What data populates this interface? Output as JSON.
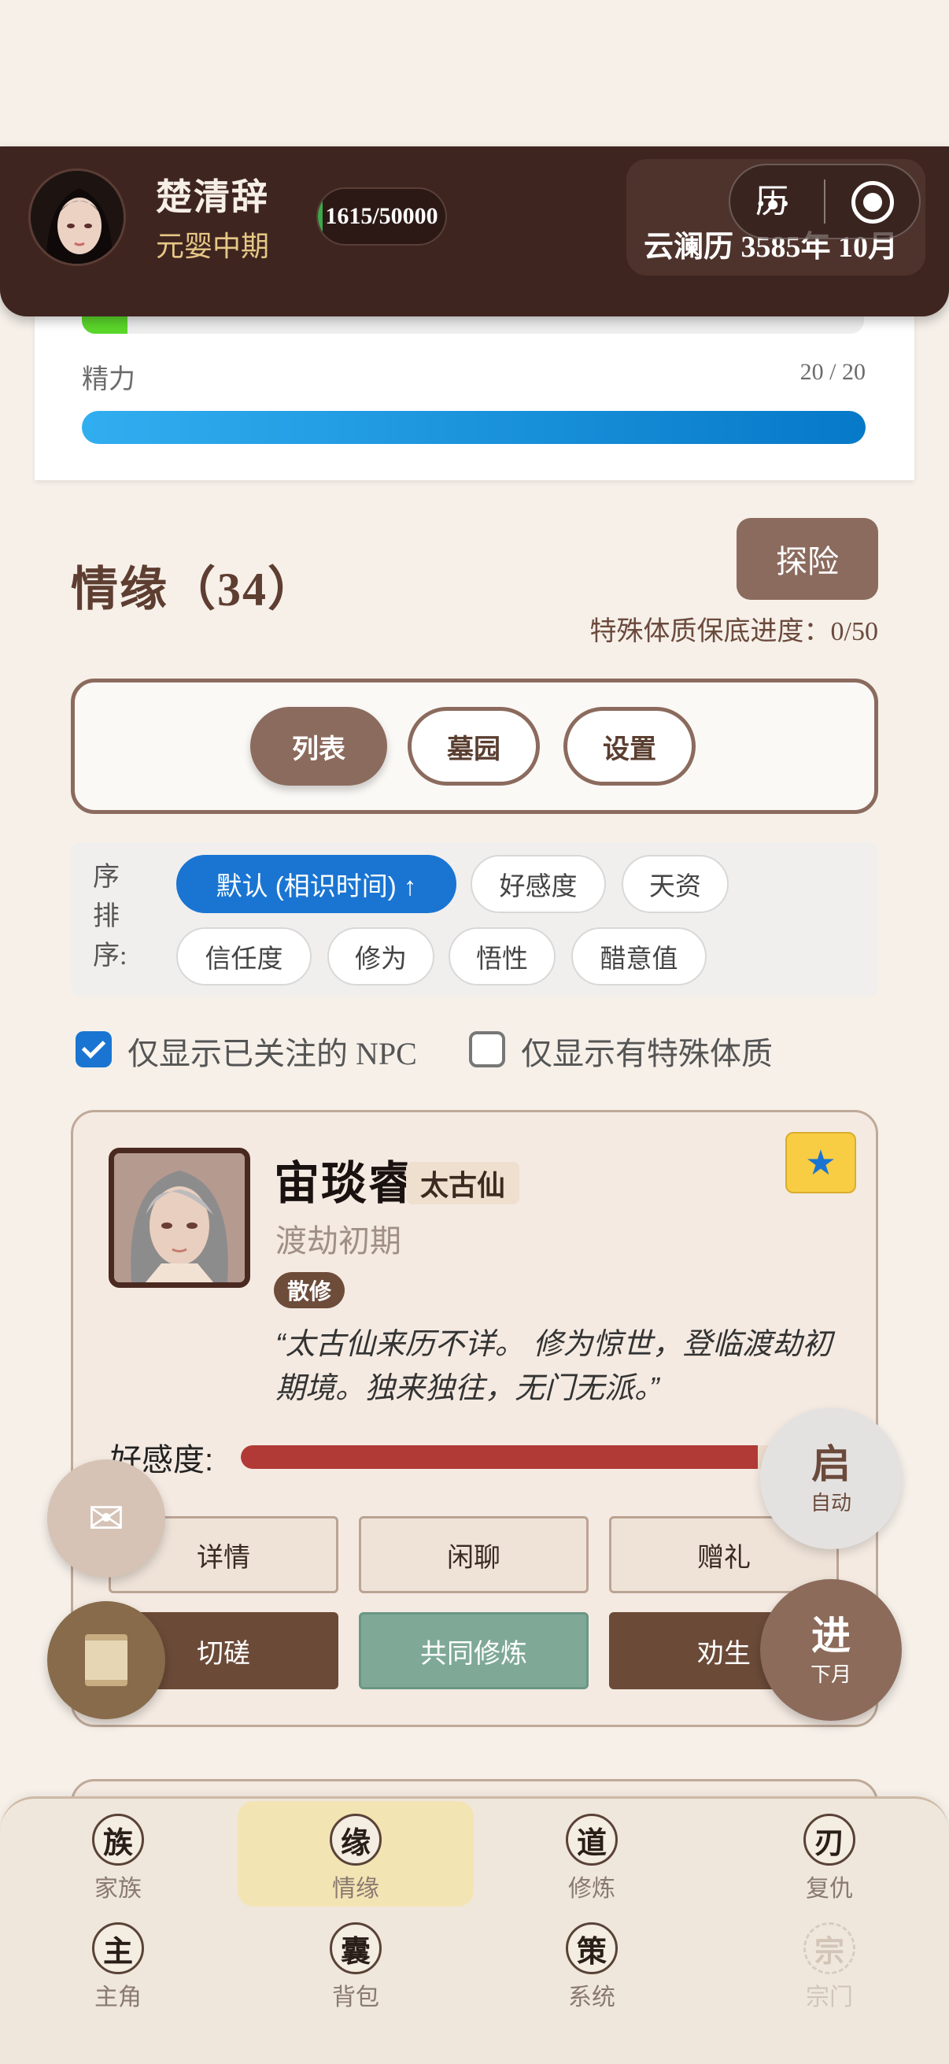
{
  "header": {
    "player_name": "楚清辞",
    "player_realm": "元婴中期",
    "exp_text": "1615/50000",
    "exp_fraction": 0.0323,
    "date_text": "云澜历 3585年 10月",
    "capsule_glyph": "历",
    "capsule_dots": "•●•"
  },
  "stats": {
    "hp_fraction": 0.06,
    "energy_label": "精力",
    "energy_value": "20 / 20",
    "energy_fraction": 1.0
  },
  "section": {
    "title": "情缘（34）",
    "explore_label": "探险",
    "progress_text": "特殊体质保底进度：0/50"
  },
  "tabs": [
    {
      "label": "列表",
      "active": true
    },
    {
      "label": "墓园",
      "active": false
    },
    {
      "label": "设置",
      "active": false
    }
  ],
  "sort": {
    "label": "序排序:",
    "options": [
      "默认 (相识时间) ↑",
      "好感度",
      "天资",
      "信任度",
      "修为",
      "悟性",
      "醋意值"
    ],
    "selected": "默认 (相识时间) ↑"
  },
  "filters": {
    "followed_only": {
      "label": "仅显示已关注的 NPC",
      "checked": true
    },
    "special_only": {
      "label": "仅显示有特殊体质",
      "checked": false
    }
  },
  "npc": {
    "name": "宙琰睿",
    "title_badge": "太古仙",
    "realm": "渡劫初期",
    "faction": "散修",
    "quote": "“太古仙来历不详。 修为惊世，登临渡劫初期境。独来独往，无门无派。”",
    "affection_label": "好感度:",
    "affection_fraction": 0.86,
    "star_glyph": "★",
    "actions": {
      "details": "详情",
      "chat": "闲聊",
      "gift": "赠礼",
      "spar": "切磋",
      "co_cultivate": "共同修炼",
      "persuade": "劝生"
    }
  },
  "fabs": {
    "mail_glyph": "✉",
    "auto_big": "启",
    "auto_small": "自动",
    "next_big": "进",
    "next_small": "下月"
  },
  "nav": [
    {
      "glyph": "族",
      "label": "家族"
    },
    {
      "glyph": "缘",
      "label": "情缘"
    },
    {
      "glyph": "道",
      "label": "修炼"
    },
    {
      "glyph": "刃",
      "label": "复仇"
    },
    {
      "glyph": "主",
      "label": "主角"
    },
    {
      "glyph": "囊",
      "label": "背包"
    },
    {
      "glyph": "策",
      "label": "系统"
    },
    {
      "glyph": "宗",
      "label": "宗门"
    }
  ],
  "colors": {
    "header_bg": "#3f2520",
    "accent_brown": "#8b6b5e",
    "active_chip_blue": "#1a75d2",
    "energy_blue": "#0679c8",
    "affection_red": "#b13a36",
    "star_yellow": "#f8cd44",
    "nav_active_bg": "#f3e4b4"
  }
}
